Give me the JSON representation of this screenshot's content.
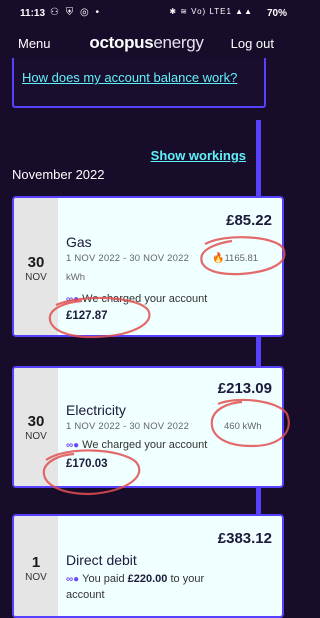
{
  "status_bar": {
    "time": "11:13",
    "left_icons": "⚇ ⛨ ◎ •",
    "right_icons": "✱ ≋ Vo) LTE1 ▲▲",
    "battery": "70%"
  },
  "header": {
    "menu_label": "Menu",
    "logo_bold": "octopus",
    "logo_light": "energy",
    "logout_label": "Log out"
  },
  "faq": {
    "link_text": "How does my account balance work?"
  },
  "show_workings_label": "Show workings",
  "month_heading": "November 2022",
  "cards": [
    {
      "day": "30",
      "month": "NOV",
      "amount": "£85.22",
      "title": "Gas",
      "period": "1 NOV 2022 - 30 NOV 2022",
      "usage_value": "1165.81",
      "usage_unit": "kWh",
      "charge_text": "We charged your account",
      "charge_amount": "£127.87"
    },
    {
      "day": "30",
      "month": "NOV",
      "amount": "£213.09",
      "title": "Electricity",
      "period": "1 NOV 2022 - 30 NOV 2022",
      "usage_value": "460 kWh",
      "charge_text": "We charged your account",
      "charge_amount": "£170.03"
    },
    {
      "day": "1",
      "month": "NOV",
      "amount": "£383.12",
      "title": "Direct debit",
      "paid_prefix": "You paid",
      "paid_amount": "£220.00",
      "paid_suffix": "to your",
      "paid_line2": "account"
    }
  ],
  "colors": {
    "background": "#180c2b",
    "accent_purple": "#5840ff",
    "link_cyan": "#60f0f8",
    "card_bg": "#f0ffff",
    "annotation_red": "#e05050"
  }
}
